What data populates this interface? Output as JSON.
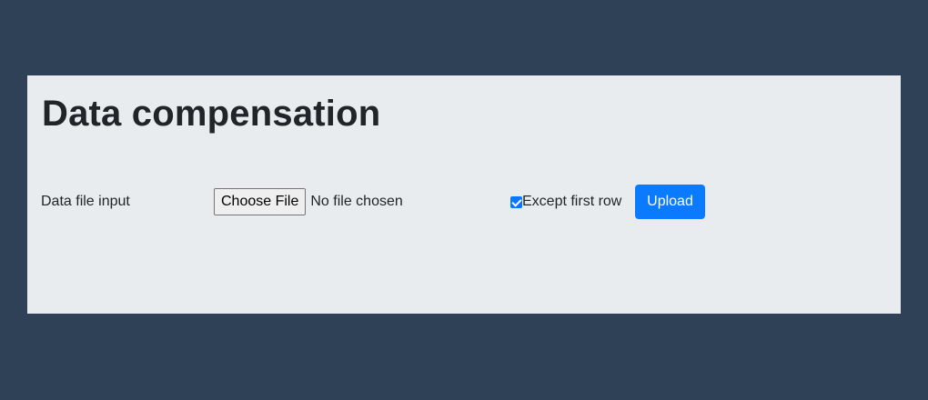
{
  "page": {
    "title": "Data compensation"
  },
  "form": {
    "label": "Data file input",
    "file_button_label": "Choose File",
    "file_status": "No file chosen",
    "checkbox_label": "Except first row",
    "checkbox_checked": true,
    "upload_label": "Upload"
  },
  "colors": {
    "background": "#2f4157",
    "panel": "#e9ecef",
    "accent": "#0a7bff"
  }
}
